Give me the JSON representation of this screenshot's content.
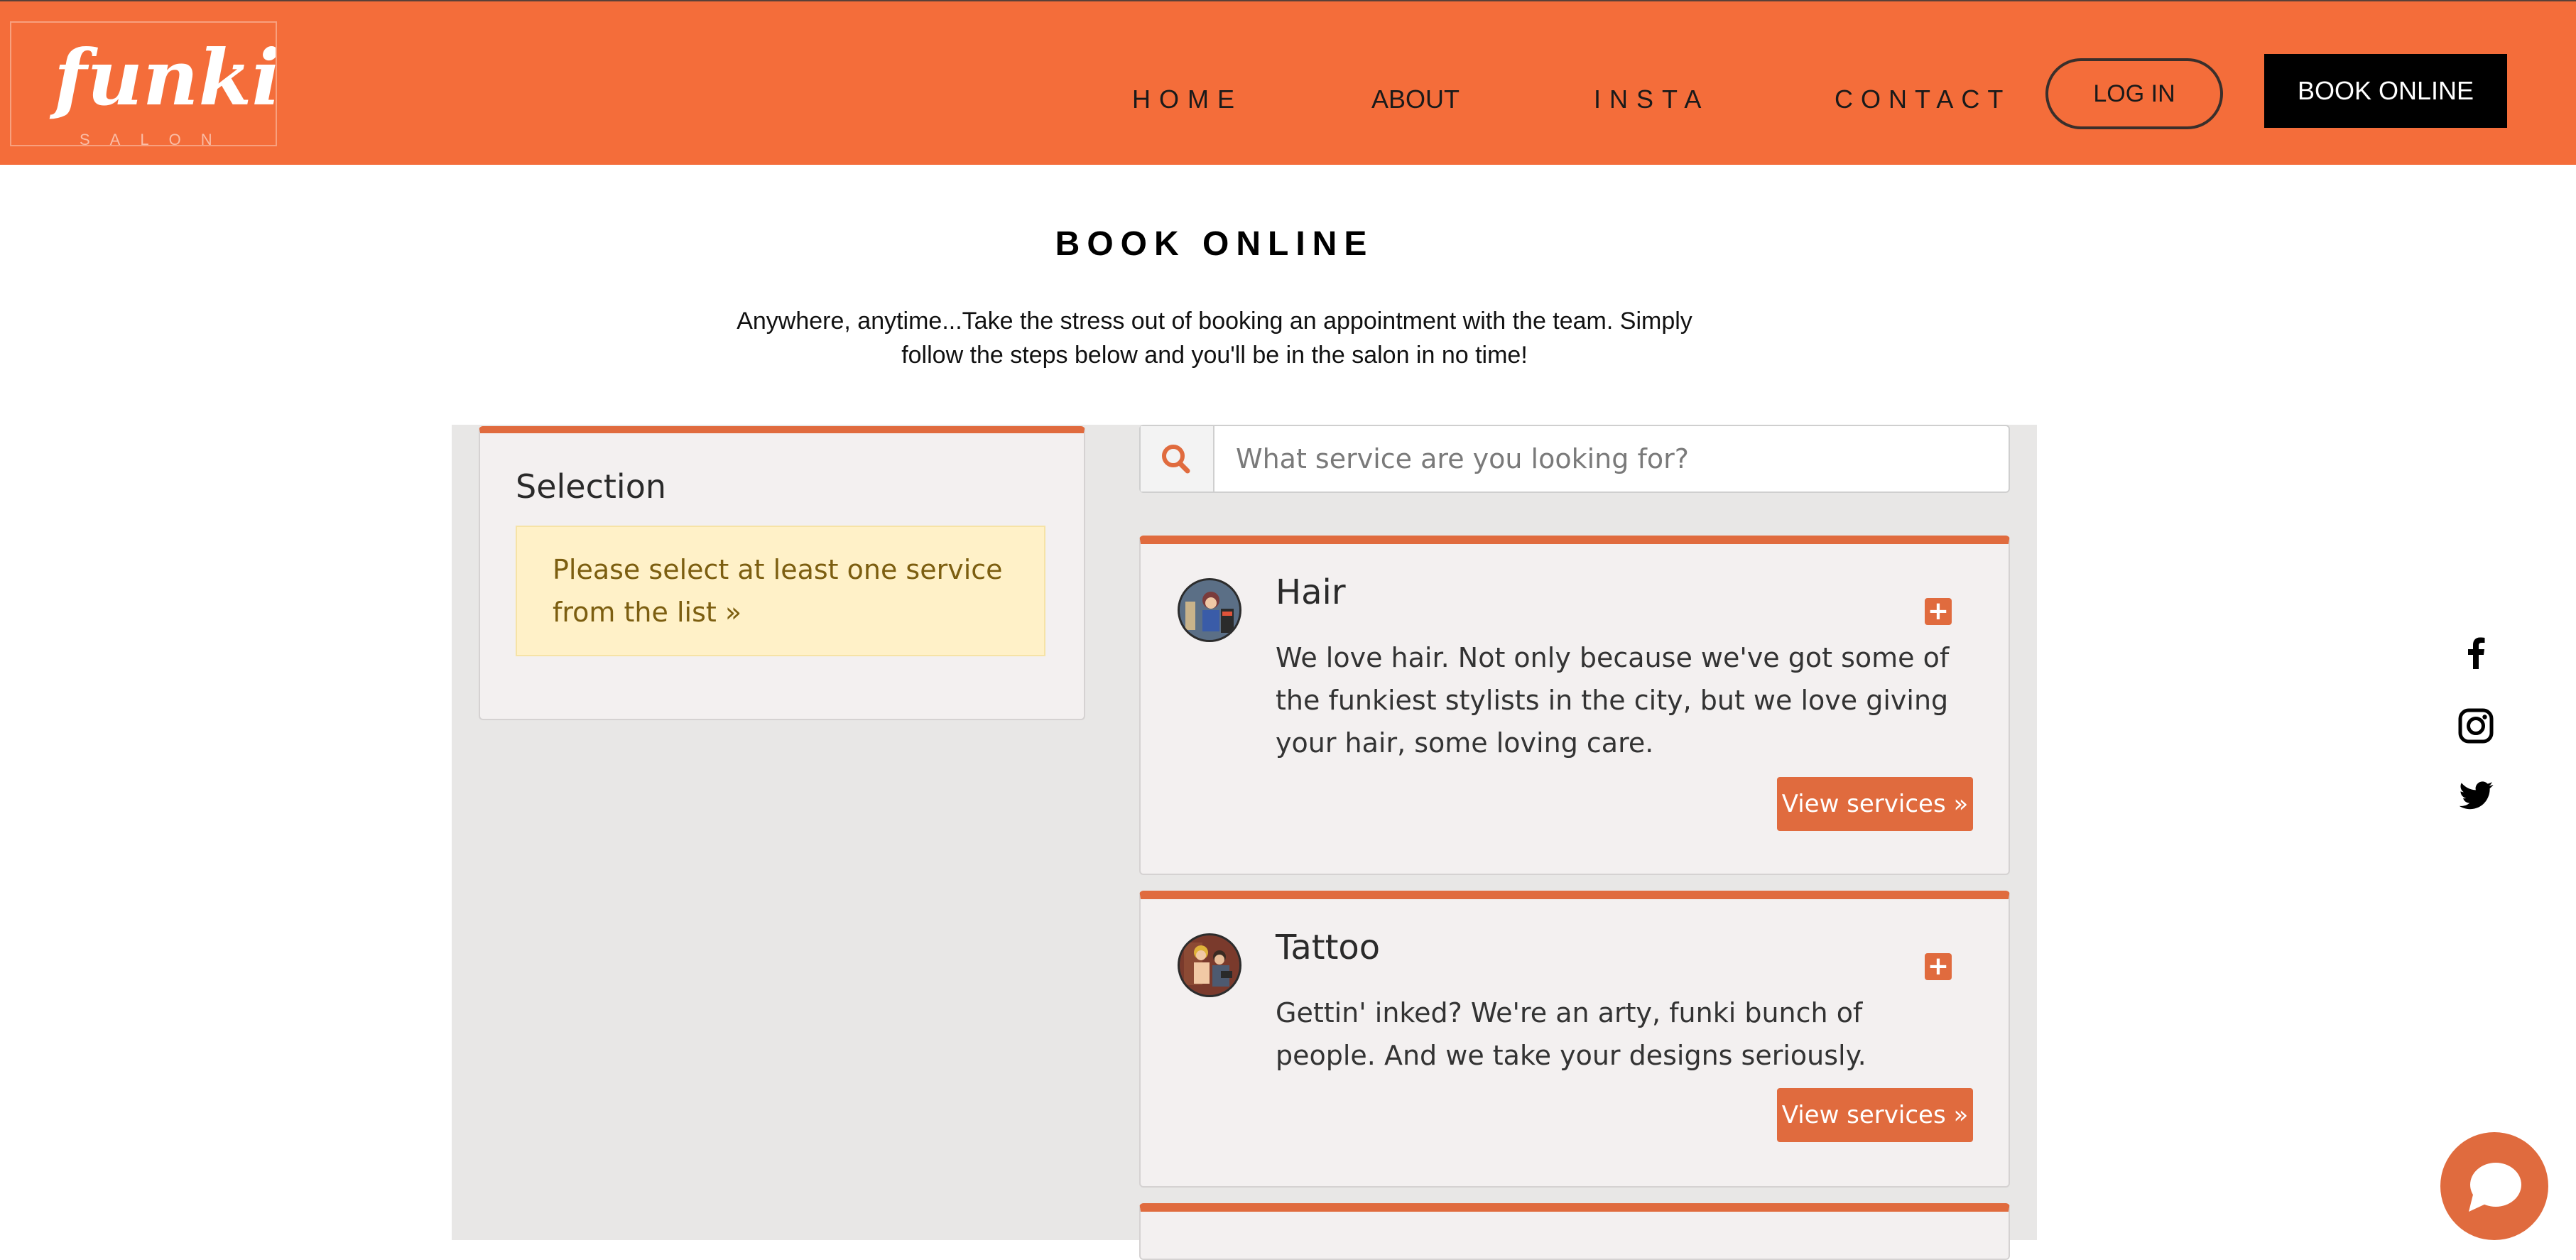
{
  "header": {
    "logo": "funki",
    "logo_sub": "SALON",
    "nav": {
      "home": "HOME",
      "about": "ABOUT",
      "insta": "INSTA",
      "contact": "CONTACT"
    },
    "login_label": "LOG IN",
    "book_label": "BOOK ONLINE"
  },
  "page": {
    "title": "BOOK ONLINE",
    "intro_line1": "Anywhere, anytime...Take the stress out of booking an appointment with the team. Simply",
    "intro_line2": "follow the steps below and you'll be in the salon in no time!"
  },
  "selection": {
    "title": "Selection",
    "alert": "Please select at least one service from the list »"
  },
  "search": {
    "placeholder": "What service are you looking for?"
  },
  "services": [
    {
      "title": "Hair",
      "description": "We love hair. Not only because we've got some of the funkiest stylists in the city, but we love giving your hair, some loving care.",
      "button": "View services »",
      "add": "+"
    },
    {
      "title": "Tattoo",
      "description": "Gettin' inked? We're an arty, funki bunch of people. And we take your designs seriously.",
      "button": "View services »",
      "add": "+"
    }
  ],
  "social": [
    "facebook-icon",
    "instagram-icon",
    "twitter-icon"
  ],
  "colors": {
    "header_bg": "#f46d3a",
    "accent": "#e06b3e",
    "alert_bg": "#fff1c8",
    "widget_bg": "#e8e7e6"
  }
}
